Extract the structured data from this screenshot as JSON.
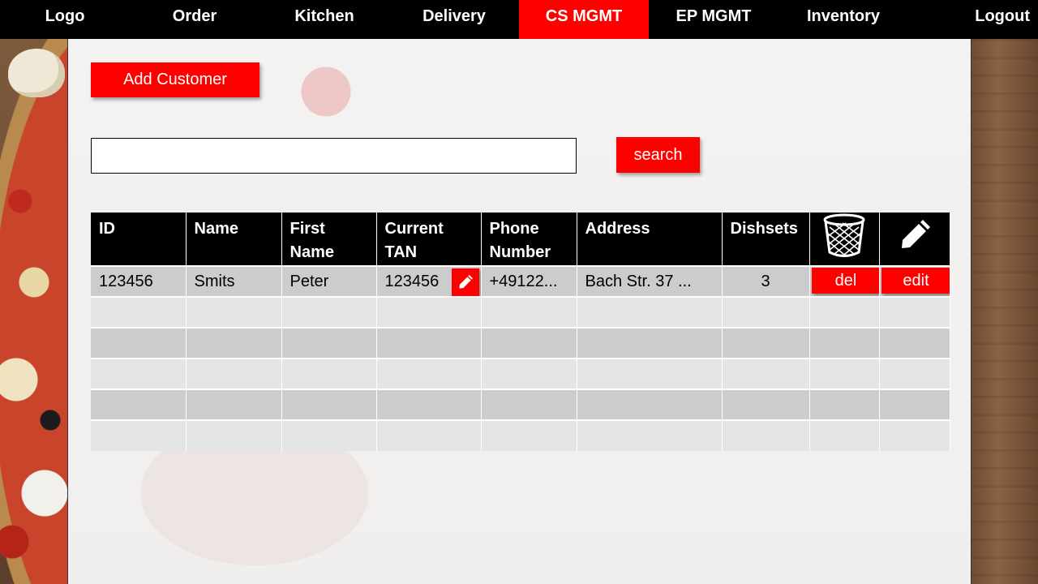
{
  "nav": {
    "items": [
      {
        "label": "Logo"
      },
      {
        "label": "Order"
      },
      {
        "label": "Kitchen"
      },
      {
        "label": "Delivery"
      },
      {
        "label": "CS MGMT"
      },
      {
        "label": "EP MGMT"
      },
      {
        "label": "Inventory"
      },
      {
        "label": "Logout"
      }
    ],
    "active": "CS MGMT"
  },
  "actions": {
    "add_customer_label": "Add Customer",
    "search_label": "search",
    "search_value": ""
  },
  "table": {
    "headers": {
      "id": "ID",
      "name": "Name",
      "first_name": "First Name",
      "current_tan": "Current TAN",
      "phone": "Phone Number",
      "address": "Address",
      "dishsets": "Dishsets",
      "delete_icon": "trash-icon",
      "edit_icon": "pencil-icon"
    },
    "rows": [
      {
        "id": "123456",
        "name": "Smits",
        "first_name": "Peter",
        "current_tan": "123456",
        "phone": "+49122...",
        "address": "Bach Str. 37 ...",
        "dishsets": "3",
        "del_label": "del",
        "edit_label": "edit"
      }
    ]
  },
  "colors": {
    "accent": "#ff0000",
    "nav_bg": "#000000",
    "row_dark": "#cccccc",
    "row_light": "#e5e5e5"
  }
}
